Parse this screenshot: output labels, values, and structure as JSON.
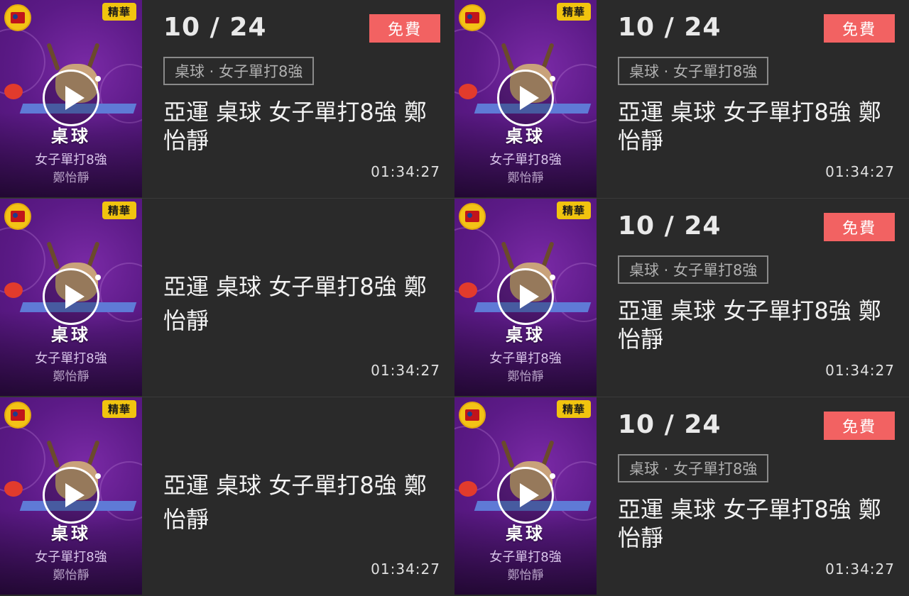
{
  "cards": [
    {
      "id": "c0",
      "thumbnail": {
        "team_badge": "中華隊",
        "highlight_tag": "精華",
        "sport": "桌球",
        "event": "女子單打8強",
        "athlete": "鄭怡靜"
      },
      "date": "10 / 24",
      "free_label": "免費",
      "category": "桌球 · 女子單打8強",
      "title": "亞運 桌球 女子單打8強 鄭怡靜",
      "duration": "01:34:27"
    },
    {
      "id": "c1",
      "thumbnail": {
        "team_badge": "中華隊",
        "highlight_tag": "精華",
        "sport": "桌球",
        "event": "女子單打8強",
        "athlete": "鄭怡靜"
      },
      "date": "10 / 24",
      "free_label": "免費",
      "category": "桌球 · 女子單打8強",
      "title": "亞運 桌球 女子單打8強 鄭怡靜",
      "duration": "01:34:27"
    },
    {
      "id": "c2",
      "thumbnail": {
        "team_badge": "中華隊",
        "highlight_tag": "精華",
        "sport": "桌球",
        "event": "女子單打8強",
        "athlete": "鄭怡靜"
      },
      "title": "亞運 桌球 女子單打8強 鄭怡靜",
      "duration": "01:34:27"
    },
    {
      "id": "c3",
      "thumbnail": {
        "team_badge": "中華隊",
        "highlight_tag": "精華",
        "sport": "桌球",
        "event": "女子單打8強",
        "athlete": "鄭怡靜"
      },
      "date": "10 / 24",
      "free_label": "免費",
      "category": "桌球 · 女子單打8強",
      "title": "亞運 桌球 女子單打8強 鄭怡靜",
      "duration": "01:34:27"
    },
    {
      "id": "c4",
      "thumbnail": {
        "team_badge": "中華隊",
        "highlight_tag": "精華",
        "sport": "桌球",
        "event": "女子單打8強",
        "athlete": "鄭怡靜"
      },
      "title": "亞運 桌球 女子單打8強 鄭怡靜",
      "duration": "01:34:27"
    },
    {
      "id": "c5",
      "thumbnail": {
        "team_badge": "中華隊",
        "highlight_tag": "精華",
        "sport": "桌球",
        "event": "女子單打8強",
        "athlete": "鄭怡靜"
      },
      "date": "10 / 24",
      "free_label": "免費",
      "category": "桌球 · 女子單打8強",
      "title": "亞運 桌球 女子單打8強 鄭怡靜",
      "duration": "01:34:27"
    }
  ],
  "colors": {
    "free_badge": "#f26262",
    "highlight_tag": "#f1c40f",
    "thumb_purple": "#5b1a86"
  },
  "icons": {
    "play": "play-icon",
    "team_badge": "team-badge-icon"
  }
}
